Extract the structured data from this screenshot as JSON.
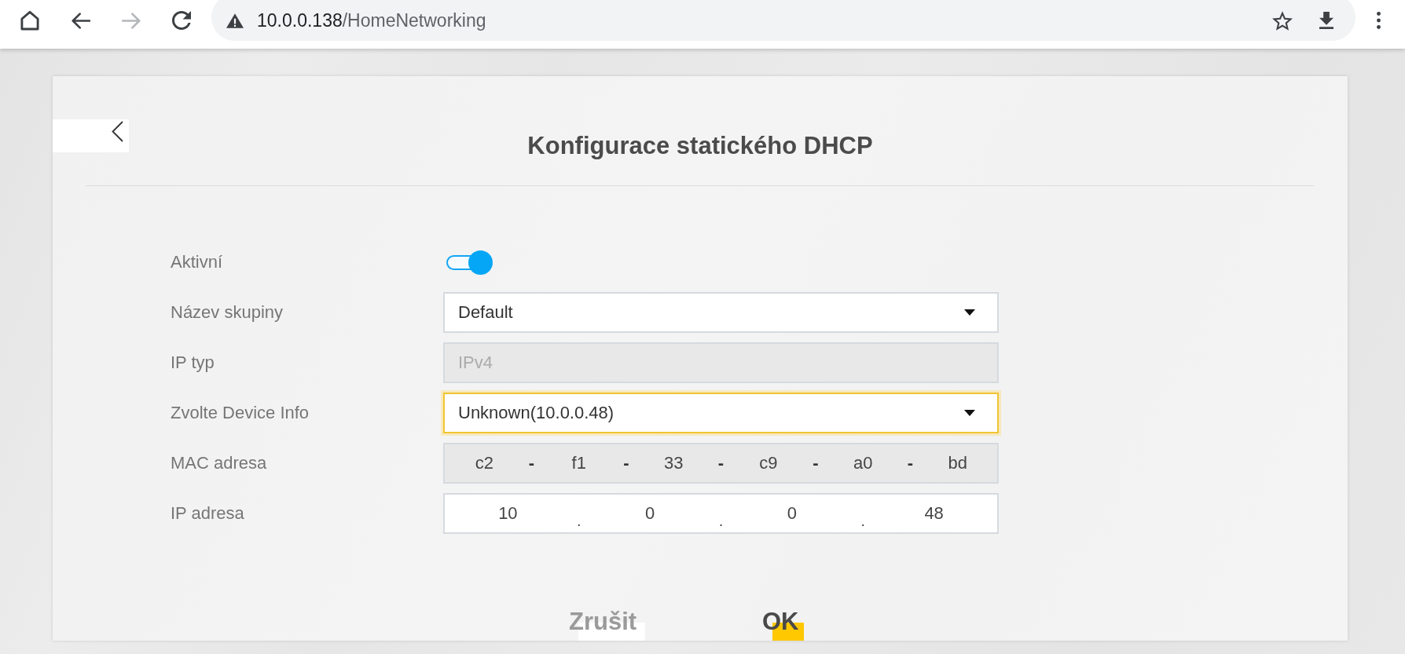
{
  "browser": {
    "nav_buttons": [
      {
        "kind": "home",
        "disabled": false
      },
      {
        "kind": "back",
        "disabled": false
      },
      {
        "kind": "forward",
        "disabled": true
      },
      {
        "kind": "reload",
        "disabled": false
      }
    ],
    "address_bar": {
      "host": "10.0.0.138",
      "path": "/HomeNetworking"
    },
    "actions": [
      {
        "kind": "bookmark"
      },
      {
        "kind": "download"
      },
      {
        "kind": "menu"
      }
    ]
  },
  "dialog": {
    "title": "Konfigurace statického DHCP"
  },
  "form": {
    "rows": [
      {
        "kind": "toggle",
        "label": "Aktivní",
        "on": true
      },
      {
        "kind": "select",
        "label": "Název skupiny",
        "value": "Default",
        "focused": false
      },
      {
        "kind": "text",
        "label": "IP typ",
        "value": "IPv4",
        "disabled": true
      },
      {
        "kind": "select",
        "label": "Zvolte Device Info",
        "value": "Unknown(10.0.0.48)",
        "focused": true
      },
      {
        "kind": "mac_address",
        "label": "MAC adresa",
        "octets": [
          "c2",
          "f1",
          "33",
          "c9",
          "a0",
          "bd"
        ],
        "separators": [
          "-",
          "-",
          "-",
          "-",
          "-"
        ],
        "readonly": true
      },
      {
        "kind": "ip_address",
        "label": "IP adresa",
        "octets": [
          "10",
          "0",
          "0",
          "48"
        ],
        "separators": [
          ".",
          ".",
          "."
        ],
        "readonly": false
      }
    ]
  },
  "buttons": [
    {
      "label": "Zrušit",
      "kind": "cancel"
    },
    {
      "label": "OK",
      "kind": "primary"
    }
  ]
}
